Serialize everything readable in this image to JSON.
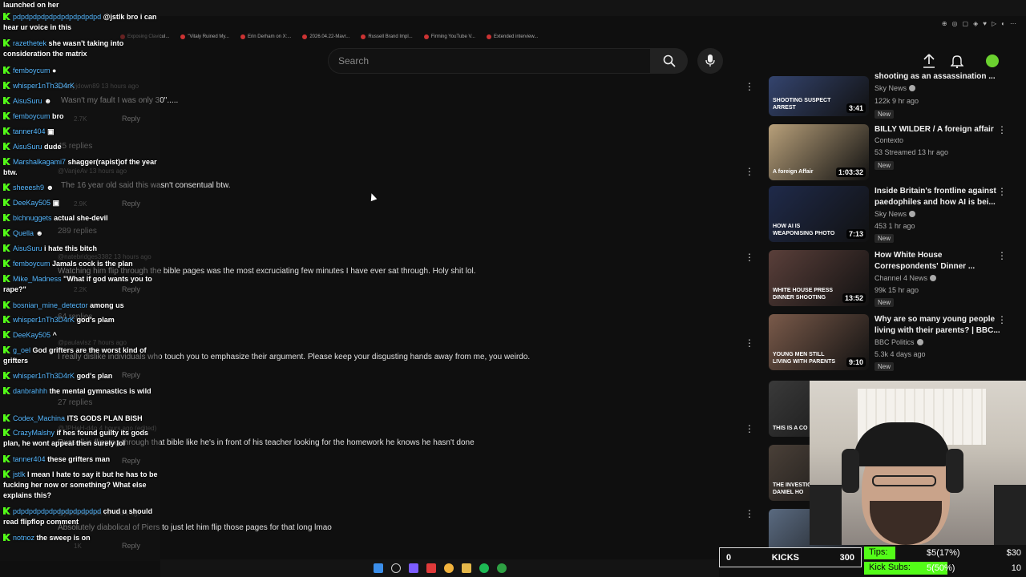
{
  "browser": {
    "bookmarks": [
      "Exposing Clavicul...",
      "\"Vitaly Ruined My...",
      "Erin Derham on X:...",
      "2026.04.22-Mavr...",
      "Russell Brand Impl...",
      "Firming YouTube V...",
      "Extended interview..."
    ]
  },
  "header": {
    "search_placeholder": "Search"
  },
  "comments": [
    {
      "meta": "@tallyjdown89 13 hours ago",
      "text": "Wasn't my fault I was only 30\".....",
      "likes": "2.7K",
      "reply": "Reply",
      "replies": "45 replies"
    },
    {
      "meta": "@VanjeAv 13 hours ago",
      "text": "The 16 year old said this wasn't consentual btw.",
      "likes": "2.9K",
      "reply": "Reply",
      "replies": "289 replies"
    },
    {
      "meta": "@natebridges3382 13 hours ago",
      "text": "Watching him flip through the bible pages was the most excruciating few minutes I have ever sat through. Holy shit lol.",
      "likes": "2.2K",
      "reply": "Reply",
      "replies": "64 replies"
    },
    {
      "meta": "@paulavisz 7 hours ago",
      "text": "I really dislike individuals who touch you to emphasize their argument. Please keep your disgusting hands away from me, you weirdo.",
      "likes": "",
      "reply": "Reply",
      "replies": "27 replies"
    },
    {
      "meta": "@JPHeH-d4p 4 hours ago (edited)",
      "text": "Russell is flipping through that bible like he's in front of his teacher looking for the homework he knows he hasn't done",
      "likes": "",
      "reply": "Reply",
      "replies": ""
    },
    {
      "meta": "@jessicaboden 15 hours ago",
      "text": "Absolutely diabolical of Piers to just let him flip those pages for that long lmao",
      "likes": "1K",
      "reply": "Reply",
      "replies": ""
    }
  ],
  "chat": [
    {
      "user": "",
      "text": "launched on her"
    },
    {
      "user": "pdpdpdpdpdpdpdpdpdpdpd",
      "text": "@jstlk bro i can hear ur voice in this"
    },
    {
      "user": "razethetek",
      "text": "she wasn't taking into consideration the matrix"
    },
    {
      "user": "femboycum",
      "text": "●"
    },
    {
      "user": "whisper1nTh3D4rK",
      "text": ""
    },
    {
      "user": "AisuSuru",
      "text": "☻"
    },
    {
      "user": "femboycum",
      "text": "bro"
    },
    {
      "user": "tanner404",
      "text": "▣"
    },
    {
      "user": "AisuSuru",
      "text": "dude"
    },
    {
      "user": "Marshalkagami7",
      "text": "shagger(rapist)of the year btw."
    },
    {
      "user": "sheeesh9",
      "text": "☻"
    },
    {
      "user": "DeeKay505",
      "text": "▣"
    },
    {
      "user": "bichnuggets",
      "text": "actual she-devil"
    },
    {
      "user": "Quella",
      "text": "☻"
    },
    {
      "user": "AisuSuru",
      "text": "i hate this bitch"
    },
    {
      "user": "femboycum",
      "text": "Jamals cock is the plan"
    },
    {
      "user": "Mike_Madness",
      "text": "\"What if god wants you to rape?\""
    },
    {
      "user": "bosnian_mine_detector",
      "text": "among us"
    },
    {
      "user": "whisper1nTh3D4rK",
      "text": "god's plam"
    },
    {
      "user": "DeeKay505",
      "text": "^"
    },
    {
      "user": "g_oel",
      "text": "God grifters are the worst kind of grifters"
    },
    {
      "user": "whisper1nTh3D4rK",
      "text": "god's plan"
    },
    {
      "user": "danbrahhh",
      "text": "the mental gymnastics is wild"
    },
    {
      "user": "Codex_Machina",
      "text": "ITS GODS PLAN BISH"
    },
    {
      "user": "CrazyMalshy",
      "text": "if hes found guilty its gods plan, he wont appeal then surely lol"
    },
    {
      "user": "tanner404",
      "text": "these grifters man"
    },
    {
      "user": "jstlk",
      "text": "I mean I hate to say it but he has to be fucking her now or something? What else explains this?"
    },
    {
      "user": "pdpdpdpdpdpdpdpdpdpdpd",
      "text": "chud u should read flipflop comment"
    },
    {
      "user": "notnoz",
      "text": "the sweep is on"
    }
  ],
  "sidebar": [
    {
      "title": "shooting as an assassination ...",
      "channel": "Sky News",
      "verified": true,
      "stats": "122k  9 hr ago",
      "badge": "New",
      "duration": "3:41",
      "thumb_text": "SHOOTING SUSPECT ARREST",
      "thumb_color": "#34446e"
    },
    {
      "title": "BILLY WILDER  / A foreign affair",
      "channel": "Contexto",
      "verified": false,
      "stats": "53  Streamed 13 hr ago",
      "badge": "New",
      "duration": "1:03:32",
      "thumb_text": "A foreign Affair",
      "thumb_color": "#b8a07a"
    },
    {
      "title": "Inside Britain's frontline against paedophiles and how AI is bei...",
      "channel": "Sky News",
      "verified": true,
      "stats": "453  1 hr ago",
      "badge": "New",
      "duration": "7:13",
      "thumb_text": "HOW AI IS WEAPONISING PHOTO",
      "thumb_color": "#1f2a4a"
    },
    {
      "title": "How White House Correspondents' Dinner ...",
      "channel": "Channel 4 News",
      "verified": true,
      "stats": "99k  15 hr ago",
      "badge": "New",
      "duration": "13:52",
      "thumb_text": "WHITE HOUSE PRESS DINNER SHOOTING",
      "thumb_color": "#5a3f3a"
    },
    {
      "title": "Why are so many young people living with their parents? | BBC...",
      "channel": "BBC Politics",
      "verified": true,
      "stats": "5.3k  4 days ago",
      "badge": "New",
      "duration": "9:10",
      "thumb_text": "YOUNG MEN STILL LIVING WITH PARENTS",
      "thumb_color": "#7a5a4a"
    },
    {
      "title": "",
      "channel": "",
      "verified": false,
      "stats": "",
      "badge": "",
      "duration": "",
      "thumb_text": "THIS IS A CO",
      "thumb_color": "#3a3a3a"
    },
    {
      "title": "",
      "channel": "",
      "verified": false,
      "stats": "",
      "badge": "",
      "duration": "",
      "thumb_text": "THE INVESTIG OF DANIEL HO",
      "thumb_color": "#4a4038"
    },
    {
      "title": "",
      "channel": "",
      "verified": false,
      "stats": "",
      "badge": "",
      "duration": "",
      "thumb_text": "",
      "thumb_color": "#5a6a80"
    }
  ],
  "overlay": {
    "kicks_count": "0",
    "kicks_label": "KICKS",
    "kicks_goal": "300",
    "tips_label": "Tips:",
    "tips_value": "$5(17%)",
    "tips_goal": "$30",
    "tips_fraction": 0.17,
    "subs_label": "Kick Subs:",
    "subs_value": "5(50%)",
    "subs_goal": "10",
    "subs_fraction": 0.5
  },
  "colors": {
    "kick_green": "#53fc18",
    "youtube_bg": "#0f0f0f"
  }
}
